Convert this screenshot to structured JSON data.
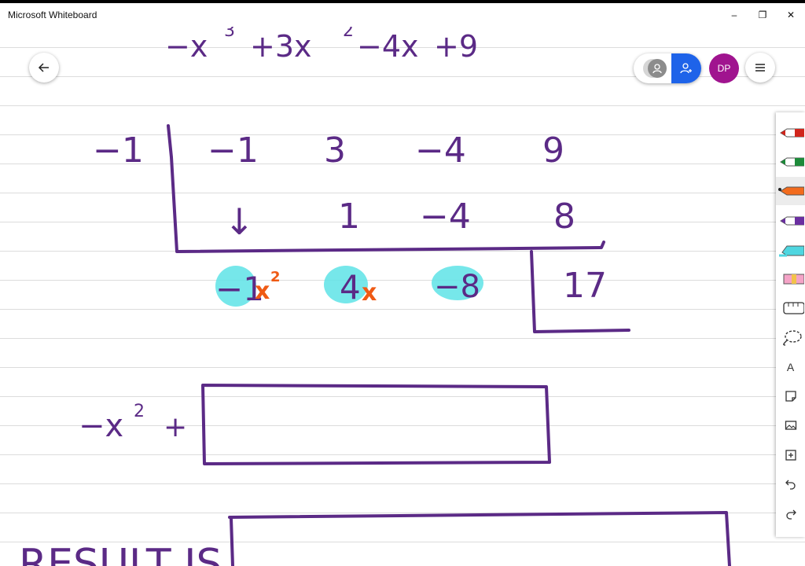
{
  "app": {
    "title": "Microsoft Whiteboard"
  },
  "window_controls": {
    "minimize": "–",
    "restore": "❐",
    "close": "✕"
  },
  "header": {
    "avatar_initials": "DP"
  },
  "ink_colors": {
    "ink": "#5b2a86",
    "highlight": "#5ee3e6",
    "accent": "#ef5a14"
  },
  "board": {
    "polynomial": [
      "−x",
      "3",
      "+3x",
      "2",
      "−4x",
      "+9"
    ],
    "divisor": "−1",
    "row1": [
      "−1",
      "3",
      "−4",
      "9"
    ],
    "row2_arrow": "↓",
    "row2": [
      "1",
      "−4",
      "8"
    ],
    "bottom": [
      {
        "coef": "−1",
        "var": "x",
        "exp": "2"
      },
      {
        "coef": "4",
        "var": "x"
      },
      {
        "coef": "−8"
      }
    ],
    "remainder": "17",
    "quotient_prefix": [
      "−x",
      "2",
      "+"
    ],
    "result_label": "RESULT IS"
  },
  "toolbar": {
    "tools": [
      {
        "name": "red-pen",
        "color": "#d1251b"
      },
      {
        "name": "green-pen",
        "color": "#1d8a3a"
      },
      {
        "name": "orange-pen",
        "color": "#f26b1d"
      },
      {
        "name": "purple-pen",
        "color": "#6a2fa0"
      },
      {
        "name": "cyan-highlighter",
        "color": "#4fd6e0"
      },
      {
        "name": "pink-eraser",
        "color": "#f5a3c7"
      },
      {
        "name": "ruler"
      },
      {
        "name": "lasso"
      },
      {
        "name": "text",
        "label": "A"
      },
      {
        "name": "note"
      },
      {
        "name": "image"
      },
      {
        "name": "add"
      },
      {
        "name": "undo"
      },
      {
        "name": "redo"
      }
    ]
  }
}
